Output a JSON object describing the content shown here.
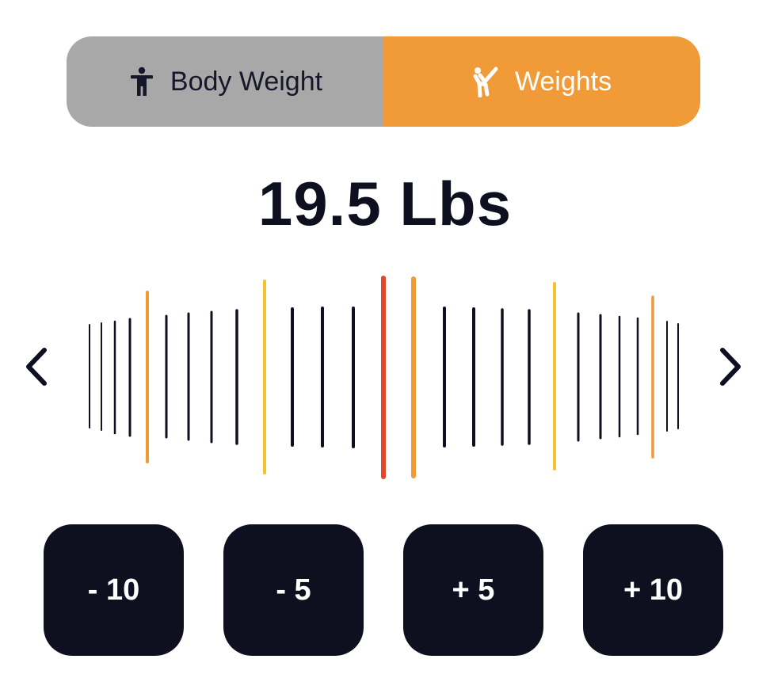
{
  "mode_toggle": {
    "options": [
      {
        "label": "Body Weight",
        "icon": "person-standing-icon",
        "selected": false
      },
      {
        "label": "Weights",
        "icon": "martial-arts-kick-icon",
        "selected": true
      }
    ],
    "active_color": "#f09a38",
    "inactive_color": "#a8a8a8"
  },
  "weight": {
    "display": "19.5 Lbs"
  },
  "ruler": {
    "prev_icon": "chevron-left-icon",
    "next_icon": "chevron-right-icon",
    "colors": {
      "tick": "#0e1020",
      "yellow": "#f2c230",
      "orange": "#f09a38",
      "selected": "#e2472a"
    }
  },
  "step_buttons": [
    {
      "label": "- 10"
    },
    {
      "label": "- 5"
    },
    {
      "label": "+ 5"
    },
    {
      "label": "+ 10"
    }
  ]
}
